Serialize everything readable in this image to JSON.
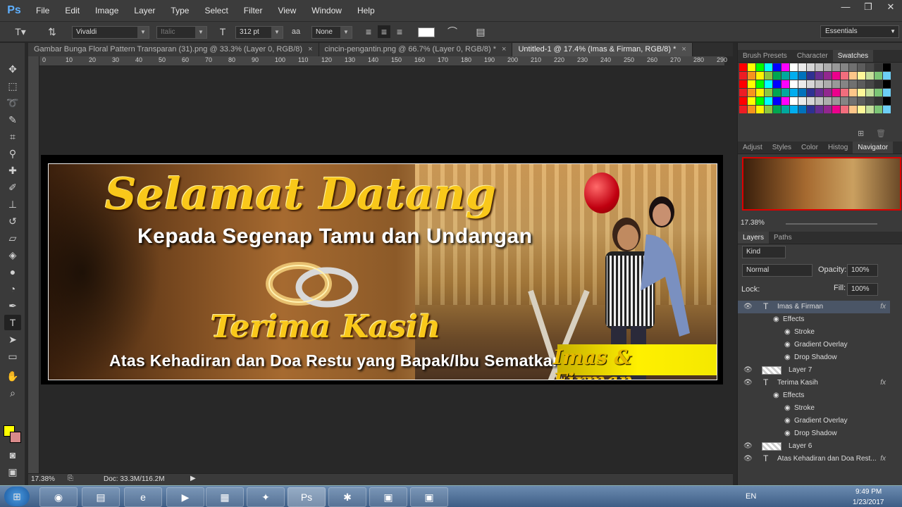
{
  "app": {
    "logo": "Ps"
  },
  "menu": [
    "File",
    "Edit",
    "Image",
    "Layer",
    "Type",
    "Select",
    "Filter",
    "View",
    "Window",
    "Help"
  ],
  "window_controls": [
    "—",
    "❐",
    "✕"
  ],
  "options": {
    "font_family": "Vivaldi",
    "font_style": "Italic",
    "font_size": "312 pt",
    "anti_alias": "None",
    "workspace": "Essentials"
  },
  "tabs": [
    {
      "label": "Gambar Bunga Floral Pattern Transparan (31).png @ 33.3% (Layer 0, RGB/8)",
      "close": "×"
    },
    {
      "label": "cincin-pengantin.png @ 66.7% (Layer 0, RGB/8) *",
      "close": "×"
    },
    {
      "label": "Untitled-1 @ 17.4% (Imas & Firman, RGB/8) *",
      "close": "×"
    }
  ],
  "ruler_labels": [
    "0",
    "10",
    "20",
    "30",
    "40",
    "50",
    "60",
    "70",
    "80",
    "90",
    "100",
    "110",
    "120",
    "130",
    "140",
    "150",
    "160",
    "170",
    "180",
    "190",
    "200",
    "210",
    "220",
    "230",
    "240",
    "250",
    "260",
    "270",
    "280",
    "290"
  ],
  "banner": {
    "title": "Selamat Datang",
    "subtitle": "Kepada Segenap Tamu dan Undangan",
    "thanks": "Terima Kasih",
    "footer": "Atas Kehadiran dan Doa Restu yang Bapak/Ibu Sematkan",
    "names": "Imas & Firman"
  },
  "status": {
    "zoom": "17.38%",
    "doc": "Doc: 33.3M/116.2M"
  },
  "panels": {
    "top_tabs": [
      "Brush Presets",
      "Character",
      "Swatches"
    ],
    "mid_tabs": [
      "Adjust",
      "Styles",
      "Color",
      "Histog",
      "Navigator"
    ],
    "nav_zoom": "17.38%",
    "layer_tabs": [
      "Layers",
      "Paths"
    ],
    "kind": "Kind",
    "blend": "Normal",
    "opacity_label": "Opacity:",
    "opacity": "100%",
    "lock_label": "Lock:",
    "fill_label": "Fill:",
    "fill": "100%"
  },
  "layers": [
    {
      "name": "Imas & Firman",
      "type": "text",
      "fx": "fx",
      "selected": true
    },
    {
      "name": "Effects",
      "type": "effects"
    },
    {
      "name": "Stroke",
      "type": "effect"
    },
    {
      "name": "Gradient Overlay",
      "type": "effect"
    },
    {
      "name": "Drop Shadow",
      "type": "effect"
    },
    {
      "name": "Layer 7",
      "type": "pixel"
    },
    {
      "name": "Terima Kasih",
      "type": "text",
      "fx": "fx"
    },
    {
      "name": "Effects",
      "type": "effects"
    },
    {
      "name": "Stroke",
      "type": "effect"
    },
    {
      "name": "Gradient Overlay",
      "type": "effect"
    },
    {
      "name": "Drop Shadow",
      "type": "effect"
    },
    {
      "name": "Layer 6",
      "type": "pixel"
    },
    {
      "name": "Atas Kehadiran dan Doa Rest...",
      "type": "text",
      "fx": "fx"
    }
  ],
  "taskbar": {
    "lang": "EN",
    "time": "9:49 PM",
    "date": "1/23/2017"
  },
  "swatch_colors": [
    "#ff0000",
    "#ffff00",
    "#00ff00",
    "#00ffff",
    "#0000ff",
    "#ff00ff",
    "#ffffff",
    "#ebebeb",
    "#d6d6d6",
    "#c2c2c2",
    "#adadad",
    "#999999",
    "#858585",
    "#707070",
    "#5c5c5c",
    "#474747",
    "#333333",
    "#000000",
    "#ed1c24",
    "#f7941d",
    "#fff200",
    "#8dc63f",
    "#00a651",
    "#00a99d",
    "#00aeef",
    "#0072bc",
    "#2e3192",
    "#662d91",
    "#92278f",
    "#ec008c",
    "#f26d7d",
    "#fdc689",
    "#fff799",
    "#c4df9b",
    "#7cc576",
    "#6dcff6"
  ]
}
